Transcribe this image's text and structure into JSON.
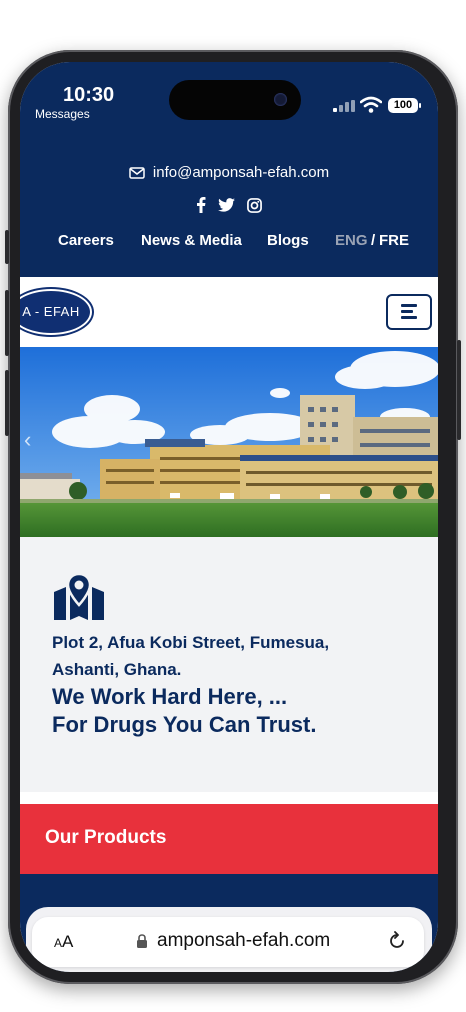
{
  "status_bar": {
    "time": "10:30",
    "back_app": "Messages",
    "battery": "100"
  },
  "header": {
    "email": "info@amponsah-efah.com",
    "social_icons": [
      "facebook-icon",
      "twitter-icon",
      "instagram-icon"
    ],
    "nav": {
      "careers": "Careers",
      "news_media": "News & Media",
      "blogs": "Blogs",
      "lang_eng": "ENG",
      "lang_sep": "/",
      "lang_fre": "FRE"
    }
  },
  "logo": {
    "text": "A - EFAH"
  },
  "info": {
    "address_line1": "Plot 2, Afua Kobi Street, Fumesua,",
    "address_line2": "Ashanti, Ghana.",
    "slogan_line1": "We Work Hard Here, ...",
    "slogan_line2": "For Drugs You Can Trust."
  },
  "products": {
    "label": "Our Products"
  },
  "safari": {
    "text_size_label": "AA",
    "url": "amponsah-efah.com"
  },
  "colors": {
    "navy": "#0b2a5e",
    "red": "#e8313c",
    "background": "#f2f3f5",
    "lang_inactive": "#9aa3b5"
  }
}
